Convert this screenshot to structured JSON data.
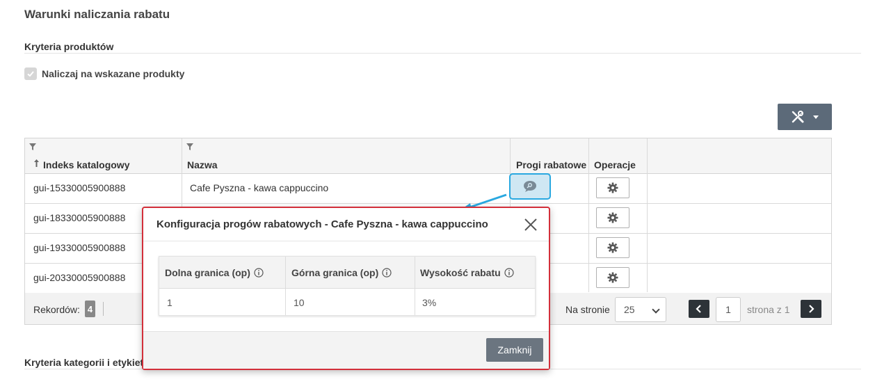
{
  "page": {
    "section_title": "Warunki naliczania rabatu",
    "product_criteria_title": "Kryteria produktów",
    "checkbox_label": "Naliczaj na wskazane produkty",
    "checkbox_checked": true,
    "category_criteria_title": "Kryteria kategorii i etykiet"
  },
  "toolbar": {
    "tools_icon": "tools-icon",
    "tools_color": "#5c6a79"
  },
  "grid": {
    "columns": [
      "Indeks katalogowy",
      "Nazwa",
      "Progi rabatowe",
      "Operacje"
    ],
    "rows": [
      {
        "index": "gui-15330005900888",
        "name": "Cafe Pyszna - kawa cappuccino"
      },
      {
        "index": "gui-18330005900888",
        "name": ""
      },
      {
        "index": "gui-19330005900888",
        "name": ""
      },
      {
        "index": "gui-20330005900888",
        "name": ""
      }
    ]
  },
  "footer": {
    "records_label": "Rekordów:",
    "records_count": "4",
    "per_page_label": "Na stronie",
    "per_page_value": "25",
    "page_value": "1",
    "page_of": "strona z 1"
  },
  "modal": {
    "title": "Konfiguracja progów rabatowych - Cafe Pyszna - kawa cappuccino",
    "columns": [
      "Dolna granica (op)",
      "Górna granica (op)",
      "Wysokość rabatu"
    ],
    "row": [
      "1",
      "10",
      "3%"
    ],
    "close_label": "Zamknij",
    "border_color": "#d32f3a"
  },
  "colors": {
    "highlight": "#29a8e0",
    "button_dark": "#2d3338"
  }
}
